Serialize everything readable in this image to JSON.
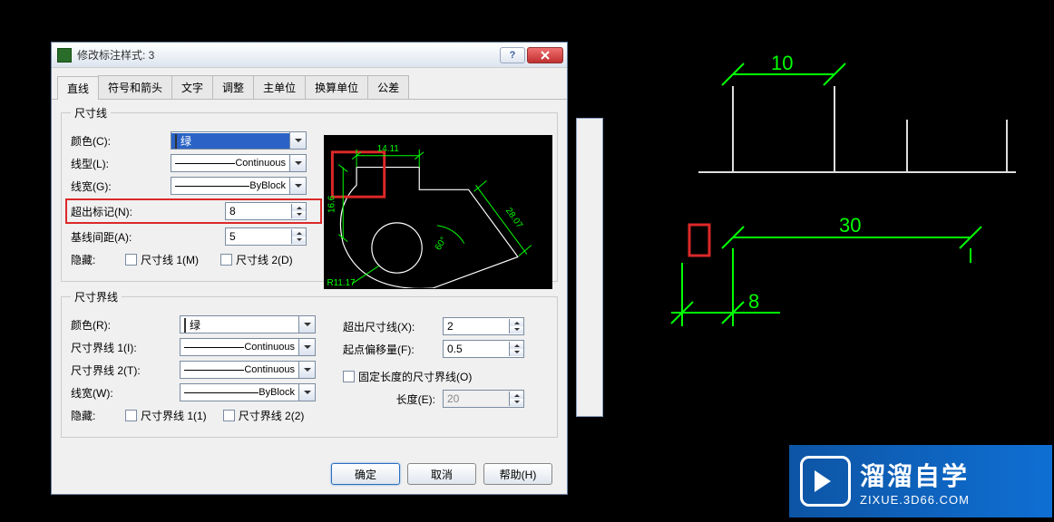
{
  "dialog": {
    "title": "修改标注样式: 3",
    "tabs": [
      "直线",
      "符号和箭头",
      "文字",
      "调整",
      "主单位",
      "换算单位",
      "公差"
    ],
    "active_tab": "直线",
    "section1": {
      "legend": "尺寸线",
      "color_label": "颜色(C):",
      "color_value": "绿",
      "color_swatch": "#00ff00",
      "linetype_label": "线型(L):",
      "linetype_value": "Continuous",
      "lineweight_label": "线宽(G):",
      "lineweight_value": "ByBlock",
      "extendmark_label": "超出标记(N):",
      "extendmark_value": "8",
      "baseline_label": "基线间距(A):",
      "baseline_value": "5",
      "hide_label": "隐藏:",
      "hide_chk1": "尺寸线 1(M)",
      "hide_chk2": "尺寸线 2(D)"
    },
    "section2": {
      "legend": "尺寸界线",
      "color_label": "颜色(R):",
      "color_value": "绿",
      "color_swatch": "#00ff00",
      "ext1_label": "尺寸界线 1(I):",
      "ext1_value": "Continuous",
      "ext2_label": "尺寸界线 2(T):",
      "ext2_value": "Continuous",
      "lineweight_label": "线宽(W):",
      "lineweight_value": "ByBlock",
      "hide_label": "隐藏:",
      "hide_chk1": "尺寸界线 1(1)",
      "hide_chk2": "尺寸界线 2(2)",
      "beyond_label": "超出尺寸线(X):",
      "beyond_value": "2",
      "offset_label": "起点偏移量(F):",
      "offset_value": "0.5",
      "fixed_chk": "固定长度的尺寸界线(O)",
      "fixed_len_label": "长度(E):",
      "fixed_len_value": "20"
    },
    "buttons": {
      "ok": "确定",
      "cancel": "取消",
      "help": "帮助(H)"
    },
    "preview_dims": {
      "d1": "14.11",
      "d2": "16.6",
      "d3": "28.07",
      "d4": "60°",
      "d5": "R11.17"
    }
  },
  "cad": {
    "dim_10": "10",
    "dim_30": "30",
    "dim_8": "8"
  },
  "watermark": {
    "big": "溜溜自学",
    "sub": "ZIXUE.3D66.COM"
  }
}
